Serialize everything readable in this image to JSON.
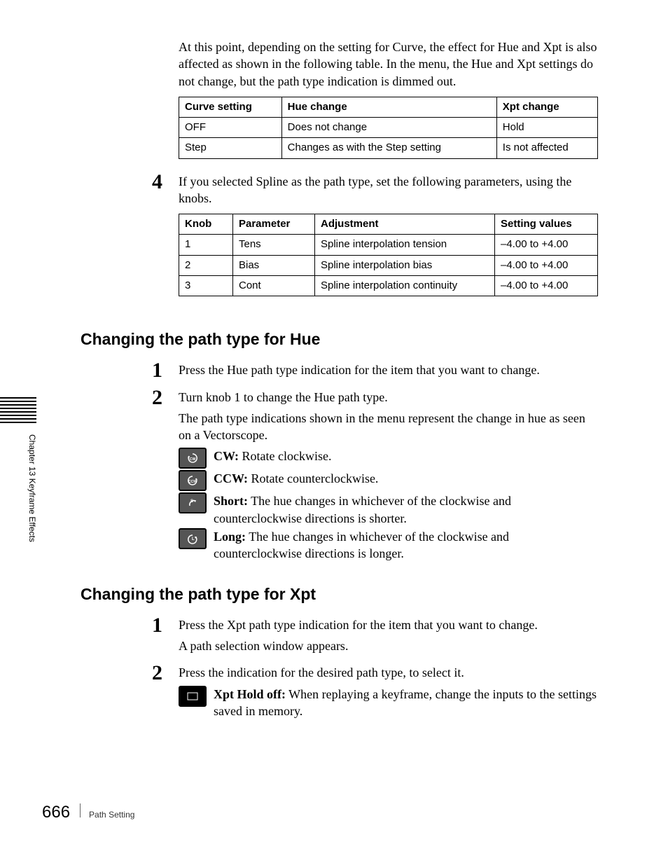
{
  "side_chapter": "Chapter 13  Keyframe Effects",
  "intro": "At this point, depending on the setting for Curve, the effect for Hue and Xpt is also affected as shown in the following table. In the menu, the Hue and Xpt settings do not change, but the path type indication is dimmed out.",
  "table1": {
    "headers": [
      "Curve setting",
      "Hue change",
      "Xpt change"
    ],
    "rows": [
      [
        "OFF",
        "Does not change",
        "Hold"
      ],
      [
        "Step",
        "Changes as with the Step setting",
        "Is not affected"
      ]
    ]
  },
  "step4_num": "4",
  "step4_text": "If you selected Spline as the path type, set the following parameters, using the knobs.",
  "table2": {
    "headers": [
      "Knob",
      "Parameter",
      "Adjustment",
      "Setting values"
    ],
    "rows": [
      [
        "1",
        "Tens",
        "Spline interpolation tension",
        "–4.00 to +4.00"
      ],
      [
        "2",
        "Bias",
        "Spline interpolation bias",
        "–4.00 to +4.00"
      ],
      [
        "3",
        "Cont",
        "Spline interpolation continuity",
        "–4.00 to +4.00"
      ]
    ]
  },
  "hue_section_title": "Changing the path type for Hue",
  "hue_step1_num": "1",
  "hue_step1_text": "Press the Hue path type indication for the item that you want to change.",
  "hue_step2_num": "2",
  "hue_step2_text": "Turn knob 1 to change the Hue path type.",
  "hue_step2_desc": "The path type indications shown in the menu represent the change in hue as seen on a Vectorscope.",
  "icons": {
    "cw_label": "CW:",
    "cw_text": " Rotate clockwise.",
    "ccw_label": "CCW:",
    "ccw_text": " Rotate counterclockwise.",
    "short_label": "Short:",
    "short_text": " The hue changes in whichever of the clockwise and counterclockwise directions is shorter.",
    "long_label": "Long:",
    "long_text": " The hue changes in whichever of the clockwise and counterclockwise directions is longer."
  },
  "xpt_section_title": "Changing the path type for Xpt",
  "xpt_step1_num": "1",
  "xpt_step1_text": "Press the Xpt path type indication for the item that you want to change.",
  "xpt_step1_desc": "A path selection window appears.",
  "xpt_step2_num": "2",
  "xpt_step2_text": "Press the indication for the desired path type, to select it.",
  "xpt_icon_label": "Xpt Hold off:",
  "xpt_icon_text": " When replaying a keyframe, change the inputs to the settings saved in memory.",
  "page_number": "666",
  "footer_text": "Path Setting"
}
